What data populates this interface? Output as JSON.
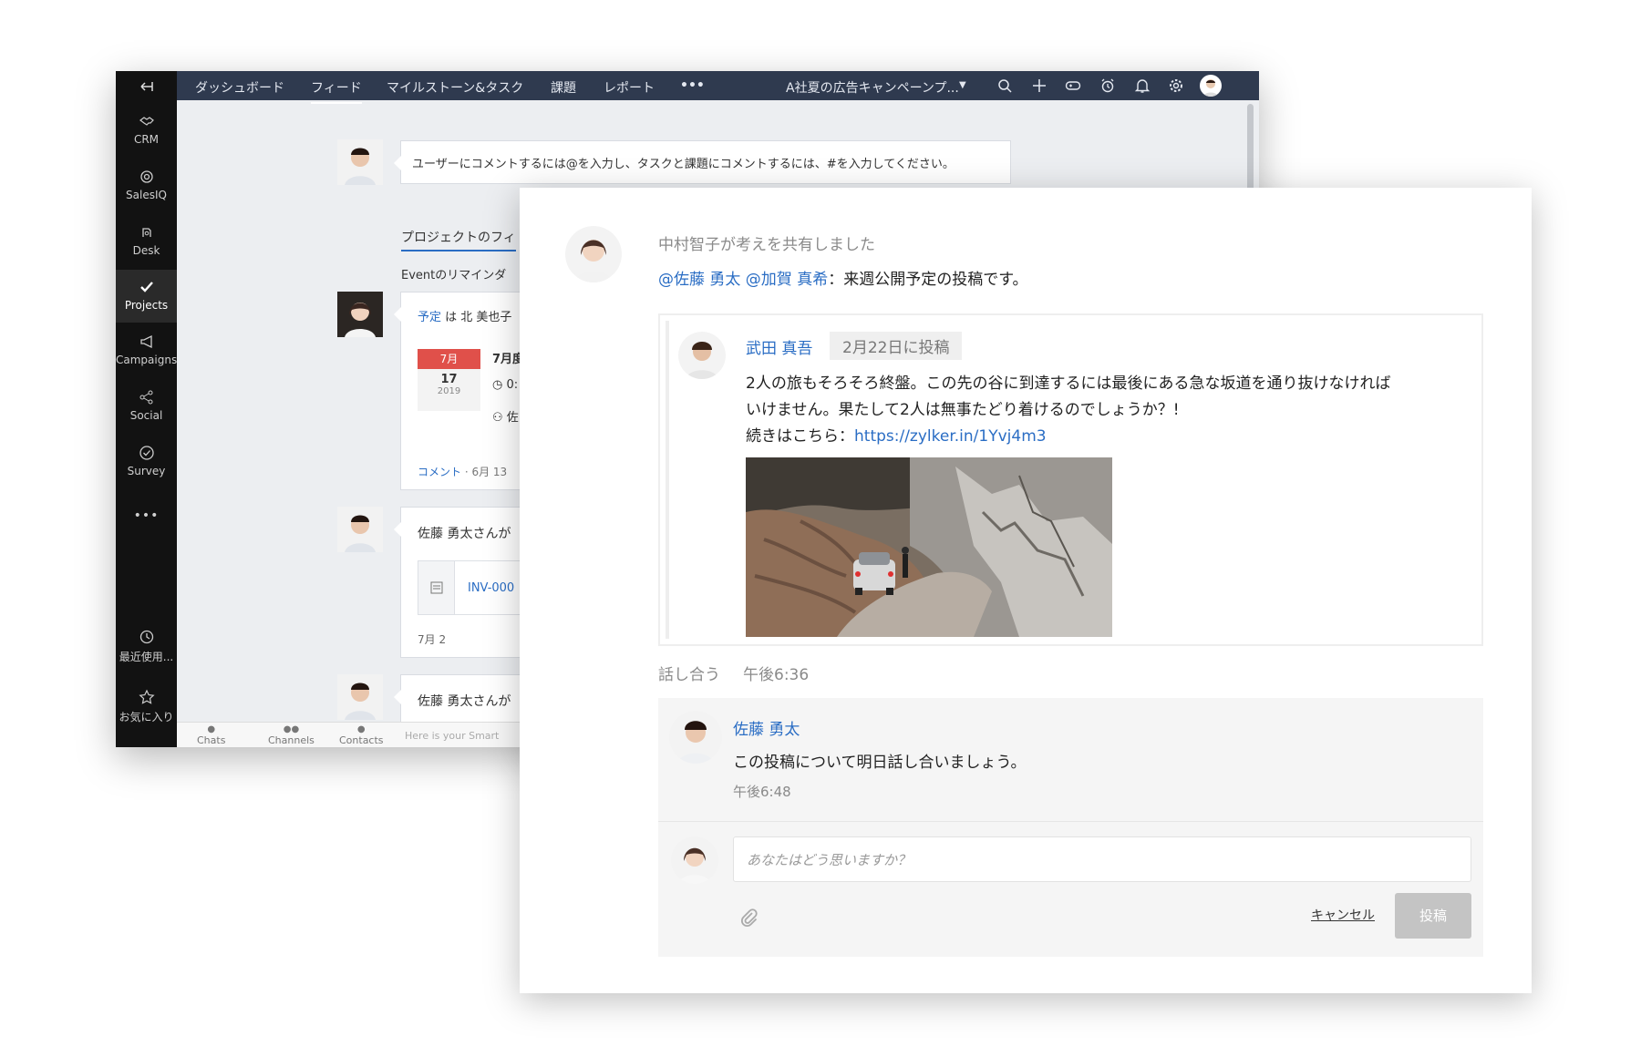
{
  "sidebar": {
    "items": [
      {
        "label": "CRM",
        "icon": "handshake-icon"
      },
      {
        "label": "SalesIQ",
        "icon": "salesiq-icon"
      },
      {
        "label": "Desk",
        "icon": "desk-icon"
      },
      {
        "label": "Projects",
        "icon": "checkmark-icon"
      },
      {
        "label": "Campaigns",
        "icon": "megaphone-icon"
      },
      {
        "label": "Social",
        "icon": "share-icon"
      },
      {
        "label": "Survey",
        "icon": "survey-icon"
      }
    ],
    "more": "•••",
    "recent": "最近使用...",
    "favorites": "お気に入り"
  },
  "topbar": {
    "tabs": [
      "ダッシュボード",
      "フィード",
      "マイルストーン&タスク",
      "課題",
      "レポート"
    ],
    "more": "•••",
    "project": "A社夏の広告キャンペーンプ..."
  },
  "feed": {
    "prompt": "ユーザーにコメントするには@を入力し、タスクと課題にコメントするには、#を入力してください。",
    "section_tab": "プロジェクトのフィ",
    "reminder": "Eventのリマインダ",
    "event_card": {
      "label_link": "予定",
      "text": "は 北 美也子",
      "month": "7月",
      "day": "17",
      "year": "2019",
      "title": "7月度",
      "time": "0:",
      "person": "佐",
      "comment_link": "コメント",
      "date": "· 6月 13"
    },
    "invoice_card": {
      "text": "佐藤 勇太さんが",
      "invoice": "INV-000",
      "date": "7月 2"
    },
    "third_card": {
      "text": "佐藤 勇太さんが"
    },
    "bottom": {
      "chats": "Chats",
      "channels": "Channels",
      "contacts": "Contacts",
      "smart": "Here is your Smart"
    }
  },
  "post": {
    "header": "中村智子が考えを共有しました",
    "mentions": "@佐藤 勇太 @加賀 真希",
    "message": "：来週公開予定の投稿です。",
    "shared": {
      "author": "武田 真吾",
      "date": "2月22日に投稿",
      "line1": "2人の旅もそろそろ終盤。この先の谷に到達するには最後にある急な坂道を通り抜けなければ",
      "line2": "いけません。果たして2人は無事たどり着けるのでしょうか？!",
      "line3": "続きはこちら：",
      "url": "https://zylker.in/1Yvj4m3"
    },
    "discuss_label": "話し合う",
    "discuss_time": "午後6:36",
    "comment": {
      "author": "佐藤 勇太",
      "text": "この投稿について明日話し合いましょう。",
      "time": "午後6:48"
    },
    "reply": {
      "placeholder": "あなたはどう思いますか？",
      "cancel": "キャンセル",
      "submit": "投稿"
    }
  }
}
